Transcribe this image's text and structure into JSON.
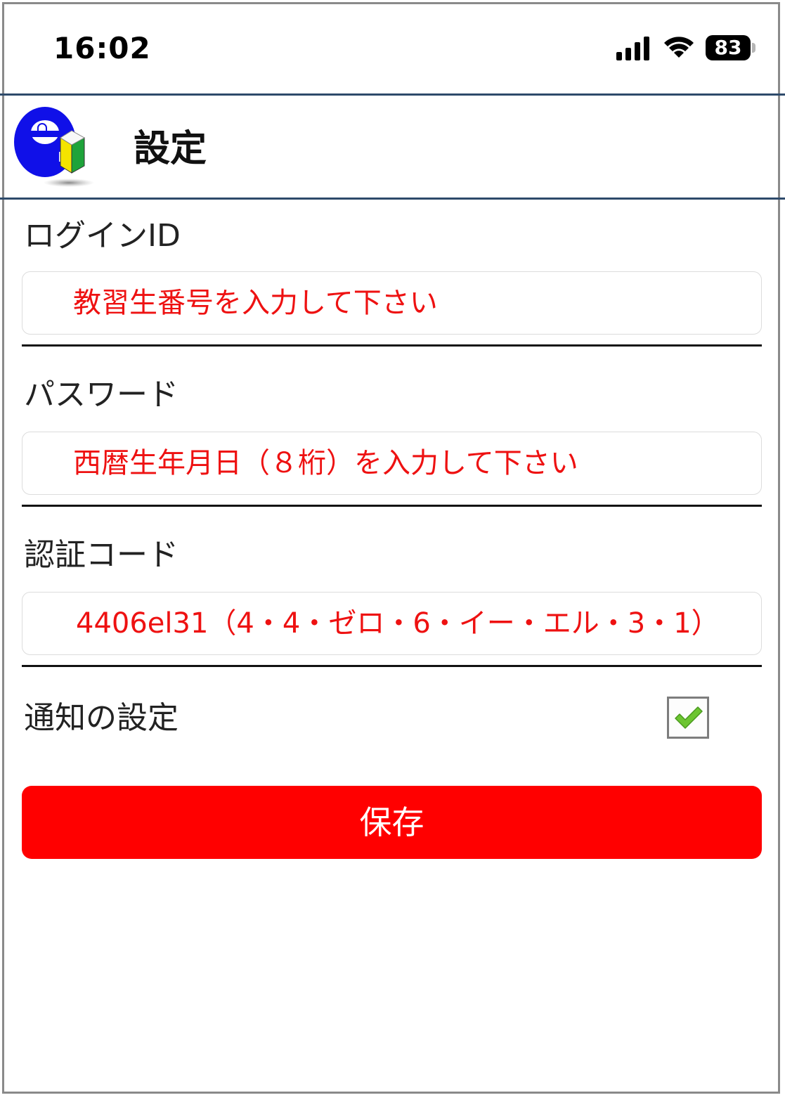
{
  "status_bar": {
    "time": "16:02",
    "battery_level": "83",
    "icons": [
      "signal-icon",
      "wifi-icon",
      "battery-icon"
    ]
  },
  "header": {
    "title": "設定",
    "logo_icon": "beginner-mark-logo-icon"
  },
  "form": {
    "login_id": {
      "label": "ログインID",
      "value": "教習生番号を入力して下さい"
    },
    "password": {
      "label": "パスワード",
      "value": "西暦生年月日（８桁）を入力して下さい"
    },
    "auth_code": {
      "label": "認証コード",
      "value": "4406el31（4・4・ゼロ・6・イー・エル・3・1）"
    },
    "notification": {
      "label": "通知の設定",
      "checked": true
    }
  },
  "save_button": {
    "label": "保存"
  },
  "colors": {
    "accent_red": "#ff0000",
    "input_text_red": "#ee1111",
    "header_line": "#2e4a6b",
    "check_green": "#6cc531"
  }
}
